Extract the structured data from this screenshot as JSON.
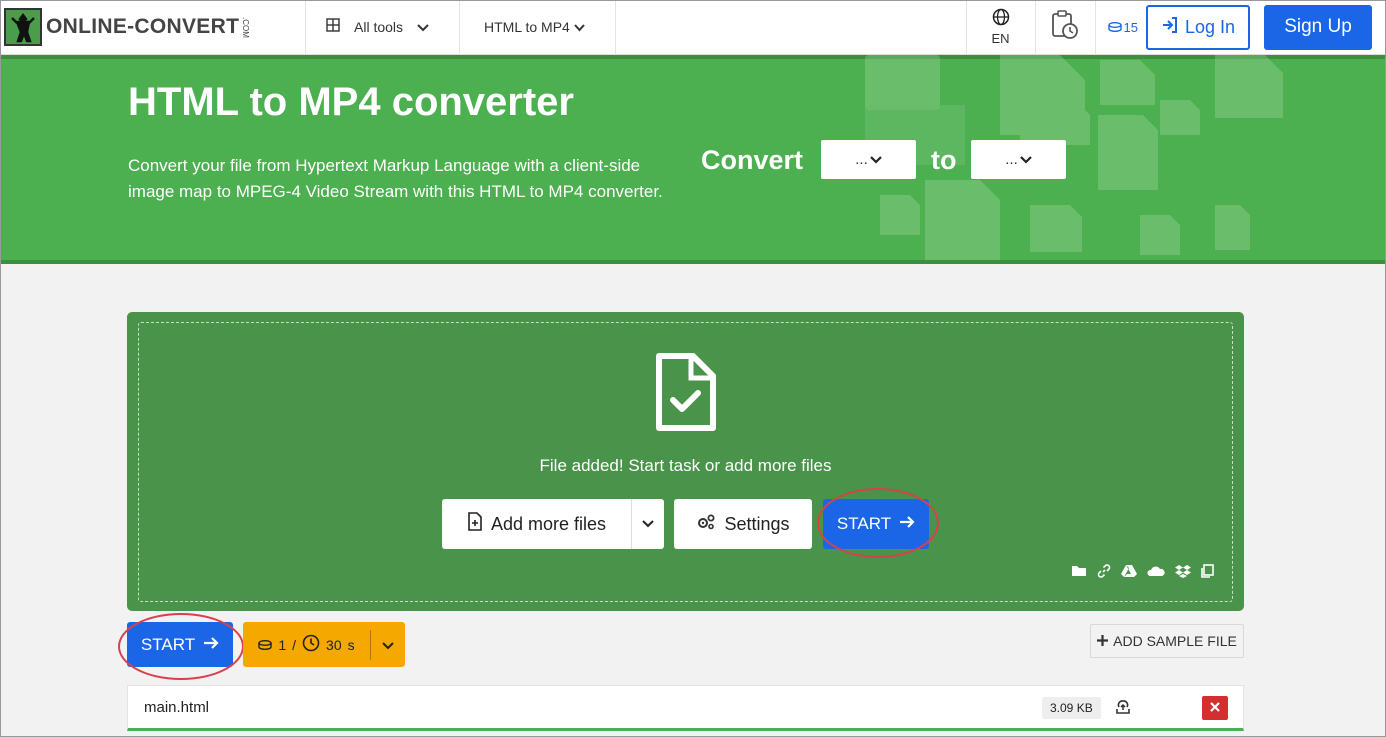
{
  "header": {
    "logo_text": "ONLINE-CONVERT",
    "logo_suffix": ".COM",
    "all_tools_label": "All tools",
    "converter_label": "HTML to MP4",
    "language": "EN",
    "credits": "15",
    "login_label": "Log In",
    "signup_label": "Sign Up"
  },
  "hero": {
    "title": "HTML to MP4 converter",
    "description": "Convert your file from Hypertext Markup Language with a client-side image map to MPEG-4 Video Stream with this HTML to MP4 converter.",
    "convert_label": "Convert",
    "to_label": "to",
    "from_select_value": "...",
    "to_select_value": "..."
  },
  "upload": {
    "message": "File added! Start task or add more files",
    "add_more_label": "Add more files",
    "settings_label": "Settings",
    "start_label": "START"
  },
  "controls": {
    "start_label": "START",
    "credit_count": "1",
    "credit_sep": "/",
    "time_value": "30",
    "time_unit": "s",
    "add_sample_label": "ADD SAMPLE FILE"
  },
  "file": {
    "name": "main.html",
    "size": "3.09 KB"
  },
  "colors": {
    "brand_blue": "#1a66e6",
    "hero_green": "#4caf50",
    "drop_green": "#4a934a",
    "credit_orange": "#f5a800",
    "delete_red": "#d32f2f",
    "highlight_ring": "#d9414a"
  }
}
